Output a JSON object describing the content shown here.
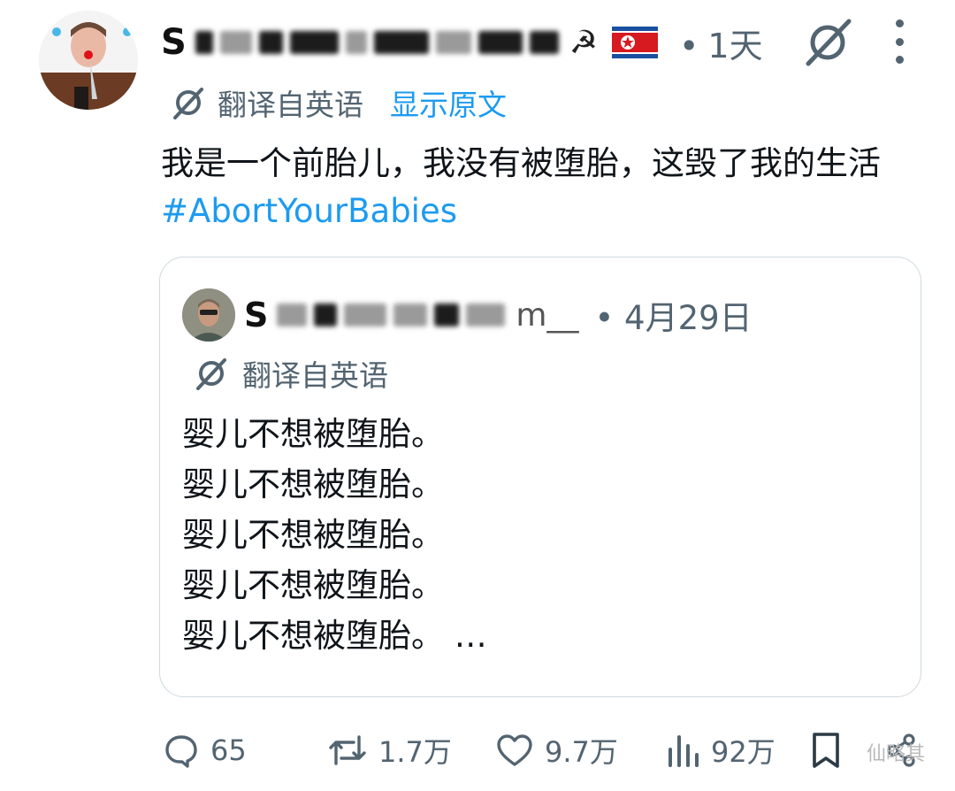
{
  "post": {
    "handle_visible": "S",
    "time": "1天",
    "dot": "•",
    "translate_label": "翻译自英语",
    "show_original": "显示原文",
    "text": "我是一个前胎儿，我没有被堕胎，这毁了我的生活",
    "hashtag": "#AbortYourBabies"
  },
  "quote": {
    "handle_visible": "S",
    "handle_tail": "m__",
    "date": "4月29日",
    "dot": "•",
    "translate_label": "翻译自英语",
    "lines": [
      "婴儿不想被堕胎。",
      "婴儿不想被堕胎。",
      "婴儿不想被堕胎。",
      "婴儿不想被堕胎。",
      "婴儿不想被堕胎。"
    ],
    "ellipsis": "…"
  },
  "actions": {
    "replies": "65",
    "reposts": "1.7万",
    "likes": "9.7万",
    "views": "92万"
  },
  "watermark": "仙略其",
  "icons": {
    "flag": "north-korea-flag",
    "emoji": "hammer-sickle",
    "translate": "grok-slash-icon"
  },
  "colors": {
    "link": "#1d9bf0",
    "secondary": "#536471",
    "border": "#cfd9de"
  }
}
